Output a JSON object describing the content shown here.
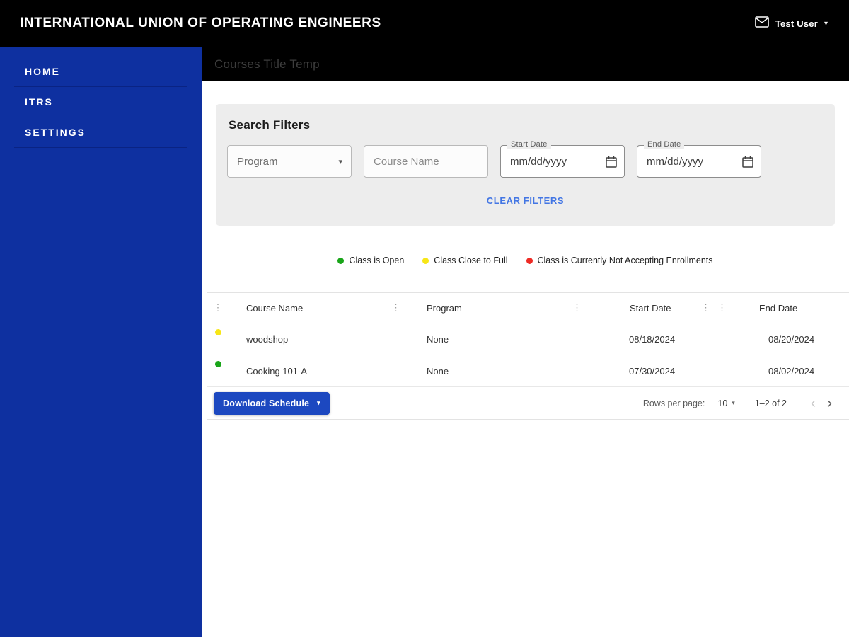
{
  "colors": {
    "header_bg": "#000000",
    "sidebar_bg": "#0e30a0",
    "button_blue": "#1c48c0",
    "link_blue": "#4376e4",
    "status_open": "#19a519",
    "status_close_to_full": "#f7e617",
    "status_closed": "#ee2b25"
  },
  "header": {
    "title": "INTERNATIONAL UNION OF OPERATING ENGINEERS",
    "user_name": "Test User"
  },
  "sidebar": {
    "items": [
      {
        "label": "HOME"
      },
      {
        "label": "ITRS"
      },
      {
        "label": "SETTINGS"
      }
    ]
  },
  "page": {
    "title": "Courses Title Temp"
  },
  "filters": {
    "title": "Search Filters",
    "program_placeholder": "Program",
    "course_name_placeholder": "Course Name",
    "start_date_label": "Start Date",
    "start_date_value": "mm/dd/yyyy",
    "end_date_label": "End Date",
    "end_date_value": "mm/dd/yyyy",
    "clear_button": "CLEAR FILTERS"
  },
  "legend": {
    "items": [
      {
        "label": "Class is Open",
        "color": "#19a519"
      },
      {
        "label": "Class Close to Full",
        "color": "#f7e617"
      },
      {
        "label": "Class is Currently Not Accepting Enrollments",
        "color": "#ee2b25"
      }
    ]
  },
  "table": {
    "columns": {
      "course_name": "Course Name",
      "program": "Program",
      "start_date": "Start Date",
      "end_date": "End Date"
    },
    "rows": [
      {
        "status": "close-to-full",
        "status_color": "#f7e617",
        "course_name": "woodshop",
        "program": "None",
        "start_date": "08/18/2024",
        "end_date": "08/20/2024"
      },
      {
        "status": "open",
        "status_color": "#19a519",
        "course_name": "Cooking 101-A",
        "program": "None",
        "start_date": "07/30/2024",
        "end_date": "08/02/2024"
      }
    ],
    "footer": {
      "download_button": "Download Schedule",
      "rows_per_page_label": "Rows per page:",
      "rows_per_page_value": "10",
      "range_label": "1–2 of 2"
    }
  }
}
